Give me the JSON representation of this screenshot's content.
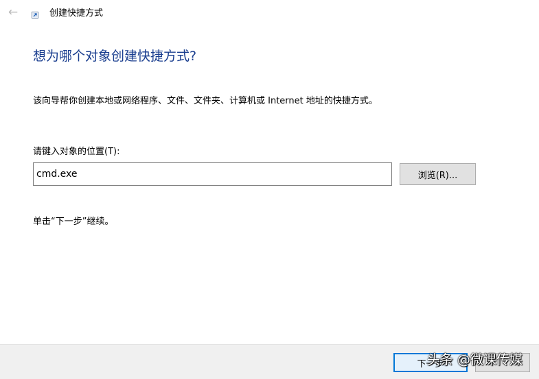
{
  "window": {
    "back_icon": "back-arrow-icon",
    "shortcut_icon": "shortcut-icon",
    "title": "创建快捷方式"
  },
  "main": {
    "heading": "想为哪个对象创建快捷方式?",
    "description": "该向导帮你创建本地或网络程序、文件、文件夹、计算机或 Internet 地址的快捷方式。",
    "location_label": "请键入对象的位置(T):",
    "location_value": "cmd.exe",
    "browse_label": "浏览(R)...",
    "continue_hint": "单击“下一步”继续。"
  },
  "footer": {
    "next_label": "下一步",
    "cancel_label": ""
  },
  "watermark": {
    "text": "头条 @微课传媒"
  },
  "colors": {
    "heading": "#1a3e8f",
    "accent_border": "#0078d7",
    "footer_bg": "#f0f0f0"
  }
}
